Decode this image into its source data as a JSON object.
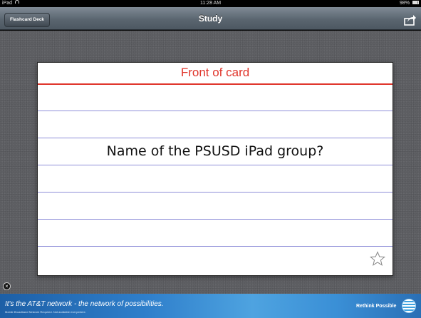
{
  "status_bar": {
    "carrier": "iPad",
    "time": "11:28 AM",
    "battery": "98%"
  },
  "nav": {
    "back_label": "Flashcard Deck",
    "title": "Study",
    "share_icon": "share-icon"
  },
  "card": {
    "heading": "Front of card",
    "question": "Name of the PSUSD iPad group?",
    "star_icon": "star-outline-icon"
  },
  "ad": {
    "tagline": "It's the AT&T network - the network of possibilities.",
    "fineprint": "Mobile Broadband Network Required. Not available everywhere.",
    "rethink": "Rethink Possible",
    "logo_icon": "att-globe-logo"
  },
  "colors": {
    "nav_bar": "#5b6670",
    "background": "#5f6064",
    "heading_red": "#e0352b",
    "rule_blue": "#8f8fd9",
    "ad_blue": "#2f7fcb"
  }
}
